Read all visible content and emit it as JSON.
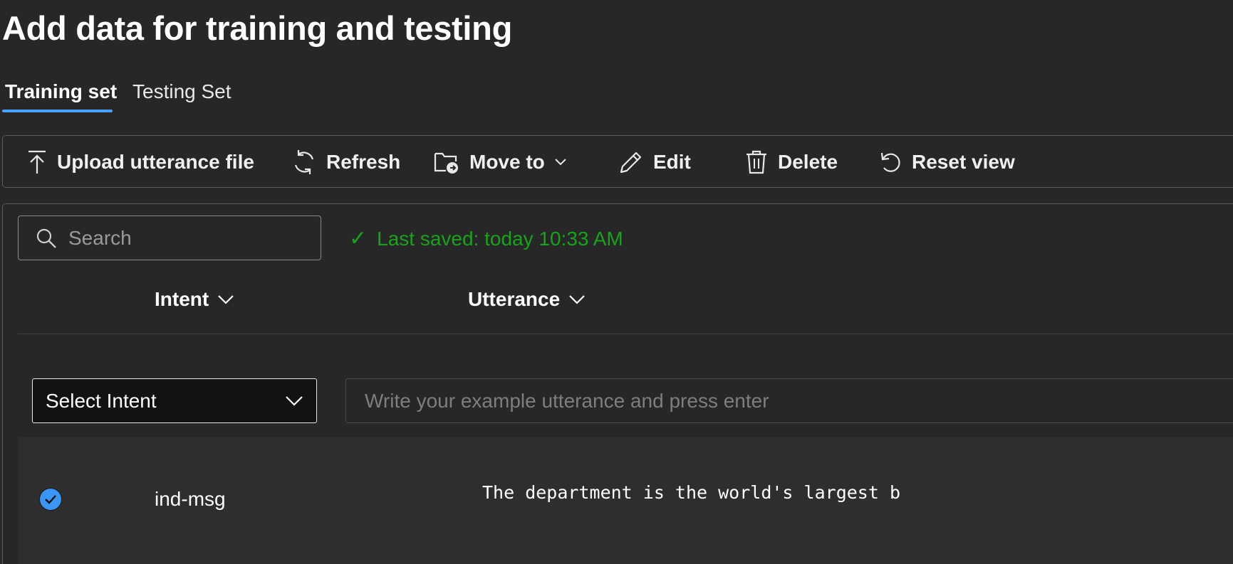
{
  "page": {
    "title": "Add data for training and testing"
  },
  "tabs": [
    {
      "label": "Training set",
      "active": true
    },
    {
      "label": "Testing Set",
      "active": false
    }
  ],
  "toolbar": {
    "upload_label": "Upload utterance file",
    "refresh_label": "Refresh",
    "move_to_label": "Move to",
    "edit_label": "Edit",
    "delete_label": "Delete",
    "reset_view_label": "Reset view"
  },
  "search": {
    "placeholder": "Search",
    "value": ""
  },
  "status": {
    "saved_text": "Last saved: today 10:33 AM",
    "color": "#17a31a"
  },
  "columns": {
    "intent": "Intent",
    "utterance": "Utterance"
  },
  "new_entry": {
    "intent_select_label": "Select Intent",
    "utterance_placeholder": "Write your example utterance and press enter"
  },
  "rows": [
    {
      "selected": true,
      "intent": "ind-msg",
      "utterance": "The department is the world's largest b"
    }
  ],
  "colors": {
    "accent": "#4aa0ff",
    "checkbox": "#3a96f5",
    "background": "#272727"
  }
}
